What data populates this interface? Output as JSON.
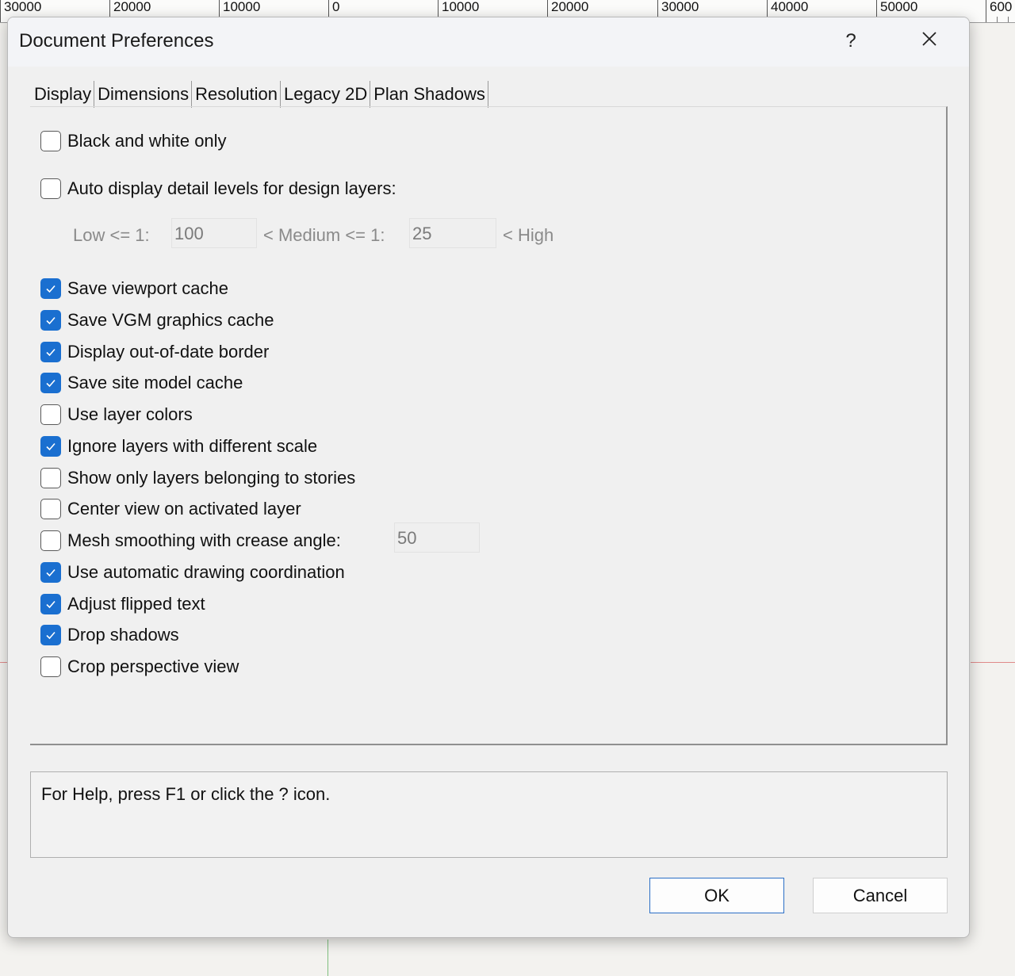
{
  "ruler": {
    "labels": [
      "30000",
      "20000",
      "10000",
      "0",
      "10000",
      "20000",
      "30000",
      "40000",
      "50000",
      "600"
    ]
  },
  "dialog": {
    "title": "Document Preferences",
    "help_button": "?",
    "close_button": "✕",
    "tabs": [
      "Display",
      "Dimensions",
      "Resolution",
      "Legacy 2D",
      "Plan Shadows"
    ],
    "active_tab": "Display",
    "options": {
      "black_white": {
        "label": "Black and white only",
        "checked": false
      },
      "auto_display": {
        "label": "Auto display detail levels for design layers:",
        "checked": false
      }
    },
    "detail_levels": {
      "low_label": "Low <= 1:",
      "low_value": "100",
      "medium_label": "< Medium <= 1:",
      "medium_value": "25",
      "high_label": "< High"
    },
    "checkboxes": [
      {
        "label": "Save viewport cache",
        "checked": true
      },
      {
        "label": "Save VGM graphics cache",
        "checked": true
      },
      {
        "label": "Display out-of-date border",
        "checked": true
      },
      {
        "label": "Save site model cache",
        "checked": true
      },
      {
        "label": "Use layer colors",
        "checked": false
      },
      {
        "label": "Ignore layers with different scale",
        "checked": true
      },
      {
        "label": "Show only layers belonging to stories",
        "checked": false
      },
      {
        "label": "Center view on activated layer",
        "checked": false
      },
      {
        "label": "Mesh smoothing with crease angle:",
        "checked": false
      },
      {
        "label": "Use automatic drawing coordination",
        "checked": true
      },
      {
        "label": "Adjust flipped text",
        "checked": true
      },
      {
        "label": "Drop shadows",
        "checked": true
      },
      {
        "label": "Crop perspective view",
        "checked": false
      }
    ],
    "crease_angle_value": "50",
    "help_text": "For Help, press F1 or click the ? icon.",
    "ok_label": "OK",
    "cancel_label": "Cancel"
  },
  "colors": {
    "accent": "#1a6fd0",
    "dialog_bg": "#f0f0f0"
  }
}
